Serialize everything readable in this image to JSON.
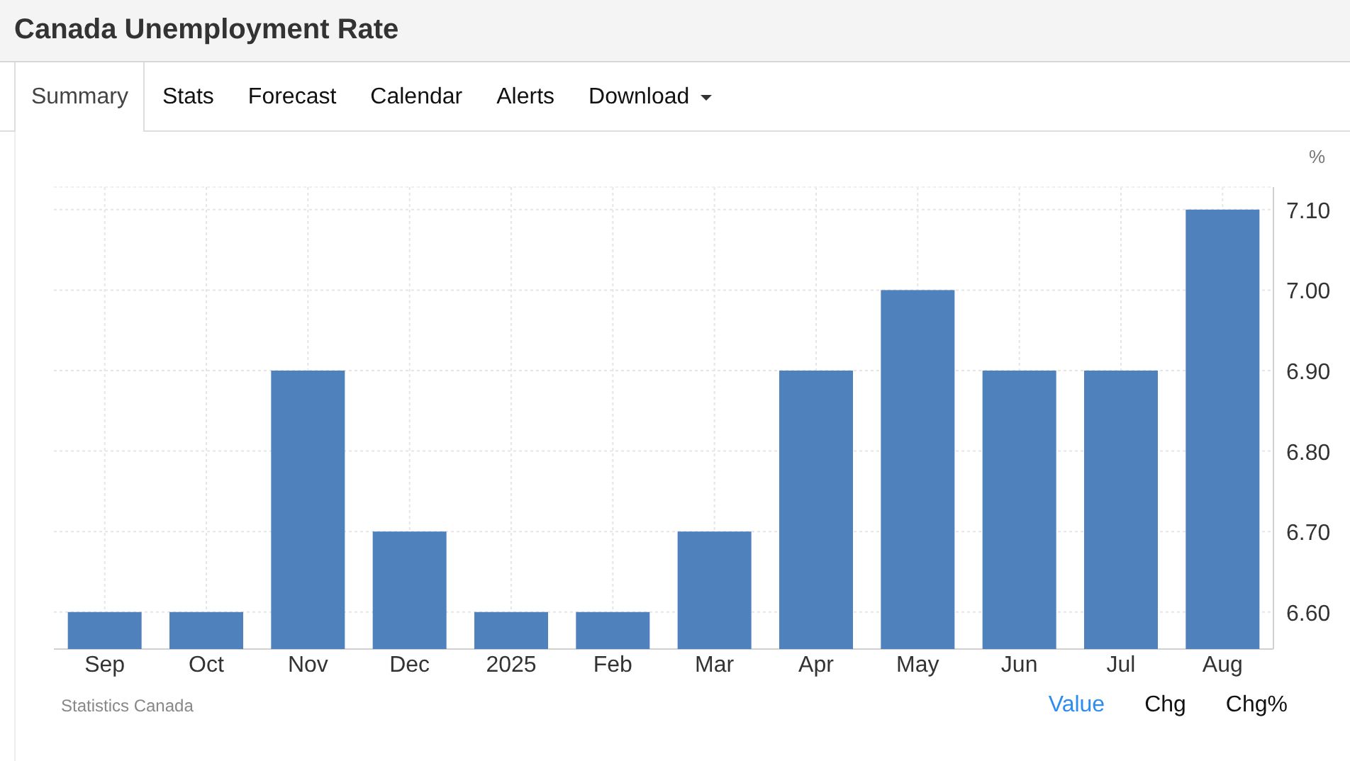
{
  "title": "Canada Unemployment Rate",
  "tabs": [
    {
      "label": "Summary",
      "selected": true,
      "dropdown": false
    },
    {
      "label": "Stats",
      "selected": false,
      "dropdown": false
    },
    {
      "label": "Forecast",
      "selected": false,
      "dropdown": false
    },
    {
      "label": "Calendar",
      "selected": false,
      "dropdown": false
    },
    {
      "label": "Alerts",
      "selected": false,
      "dropdown": false
    },
    {
      "label": "Download",
      "selected": false,
      "dropdown": true
    }
  ],
  "chart_data": {
    "type": "bar",
    "ylabel": "%",
    "categories": [
      "Sep",
      "Oct",
      "Nov",
      "Dec",
      "2025",
      "Feb",
      "Mar",
      "Apr",
      "May",
      "Jun",
      "Jul",
      "Aug"
    ],
    "grid": true,
    "series": [
      {
        "color": "#4f81bd",
        "values": [
          6.6,
          6.6,
          6.9,
          6.7,
          6.6,
          6.6,
          6.7,
          6.9,
          7.0,
          6.9,
          6.9,
          7.1
        ]
      }
    ],
    "ylim": [
      6.554,
      7.128
    ],
    "yticks": [
      {
        "value": 6.6,
        "label": "6.60"
      },
      {
        "value": 6.7,
        "label": "6.70"
      },
      {
        "value": 6.8,
        "label": "6.80"
      },
      {
        "value": 6.9,
        "label": "6.90"
      },
      {
        "value": 7.0,
        "label": "7.00"
      },
      {
        "value": 7.1,
        "label": "7.10"
      }
    ]
  },
  "source": "Statistics Canada",
  "views": [
    {
      "label": "Value",
      "selected": true
    },
    {
      "label": "Chg",
      "selected": false
    },
    {
      "label": "Chg%",
      "selected": false
    }
  ]
}
